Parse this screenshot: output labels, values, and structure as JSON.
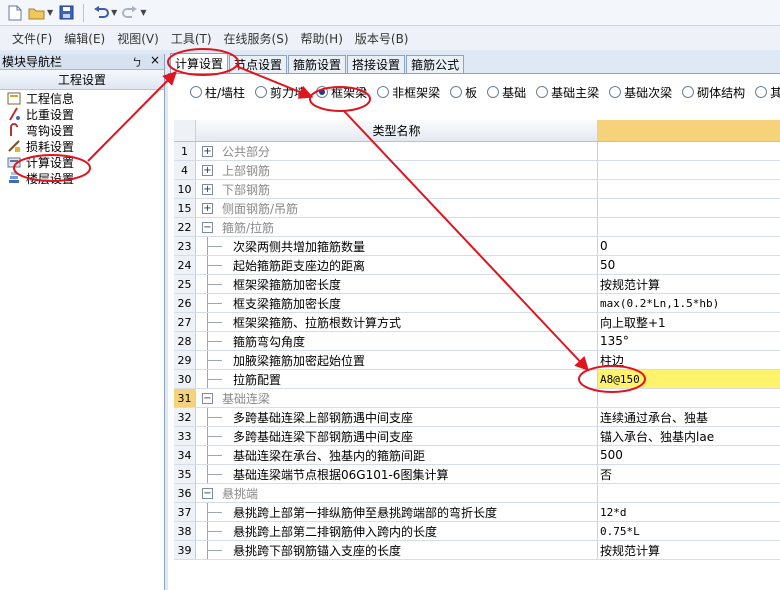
{
  "toolbar": {
    "icons": [
      "new-file-icon",
      "open-folder-icon",
      "save-icon",
      "undo-icon",
      "redo-icon"
    ]
  },
  "menu": [
    "文件(F)",
    "编辑(E)",
    "视图(V)",
    "工具(T)",
    "在线服务(S)",
    "帮助(H)",
    "版本号(B)"
  ],
  "left_panel": {
    "title": "模块导航栏",
    "pin": "ㄅ",
    "close": "×",
    "section": "工程设置",
    "items": [
      "工程信息",
      "比重设置",
      "弯钩设置",
      "损耗设置",
      "计算设置",
      "楼层设置"
    ]
  },
  "tabs": [
    "计算设置",
    "节点设置",
    "箍筋设置",
    "搭接设置",
    "箍筋公式"
  ],
  "radios": [
    "柱/墙柱",
    "剪力墙",
    "框架梁",
    "非框架梁",
    "板",
    "基础",
    "基础主梁",
    "基础次梁",
    "砌体结构",
    "其"
  ],
  "selected_radio": "框架梁",
  "grid": {
    "header": "类型名称",
    "rows": [
      {
        "n": "1",
        "kind": "cat",
        "exp": "+",
        "name": "公共部分",
        "value": ""
      },
      {
        "n": "4",
        "kind": "cat",
        "exp": "+",
        "name": "上部钢筋",
        "value": ""
      },
      {
        "n": "10",
        "kind": "cat",
        "exp": "+",
        "name": "下部钢筋",
        "value": ""
      },
      {
        "n": "15",
        "kind": "cat",
        "exp": "+",
        "name": "侧面钢筋/吊筋",
        "value": ""
      },
      {
        "n": "22",
        "kind": "cat",
        "exp": "−",
        "name": "箍筋/拉筋",
        "value": ""
      },
      {
        "n": "23",
        "kind": "item",
        "name": "次梁两侧共增加箍筋数量",
        "value": "0"
      },
      {
        "n": "24",
        "kind": "item",
        "name": "起始箍筋距支座边的距离",
        "value": "50"
      },
      {
        "n": "25",
        "kind": "item",
        "name": "框架梁箍筋加密长度",
        "value": "按规范计算"
      },
      {
        "n": "26",
        "kind": "item",
        "name": "框支梁箍筋加密长度",
        "value": "max(0.2*Ln,1.5*hb)",
        "mono": true
      },
      {
        "n": "27",
        "kind": "item",
        "name": "框架梁箍筋、拉筋根数计算方式",
        "value": "向上取整+1"
      },
      {
        "n": "28",
        "kind": "item",
        "name": "箍筋弯勾角度",
        "value": "135°"
      },
      {
        "n": "29",
        "kind": "item",
        "name": "加腋梁箍筋加密起始位置",
        "value": "柱边"
      },
      {
        "n": "30",
        "kind": "item",
        "name": "拉筋配置",
        "value": "A8@150",
        "hl": true,
        "mono": true
      },
      {
        "n": "31",
        "kind": "cat",
        "exp": "−",
        "name": "基础连梁",
        "value": "",
        "selected": true
      },
      {
        "n": "32",
        "kind": "item",
        "name": "多跨基础连梁上部钢筋遇中间支座",
        "value": "连续通过承台、独基"
      },
      {
        "n": "33",
        "kind": "item",
        "name": "多跨基础连梁下部钢筋遇中间支座",
        "value": "锚入承台、独基内lae"
      },
      {
        "n": "34",
        "kind": "item",
        "name": "基础连梁在承台、独基内的箍筋间距",
        "value": "500"
      },
      {
        "n": "35",
        "kind": "item",
        "name": "基础连梁端节点根据06G101-6图集计算",
        "value": "否"
      },
      {
        "n": "36",
        "kind": "cat",
        "exp": "−",
        "name": "悬挑端",
        "value": ""
      },
      {
        "n": "37",
        "kind": "item",
        "name": "悬挑跨上部第一排纵筋伸至悬挑跨端部的弯折长度",
        "value": "12*d",
        "mono": true
      },
      {
        "n": "38",
        "kind": "item",
        "name": "悬挑跨上部第二排钢筋伸入跨内的长度",
        "value": "0.75*L",
        "mono": true
      },
      {
        "n": "39",
        "kind": "item",
        "name": "悬挑跨下部钢筋锚入支座的长度",
        "value": "按规范计算"
      }
    ]
  },
  "colors": {
    "annotation": "#e0141e",
    "header_value": "#f6d27a",
    "highlight": "#fff36b"
  }
}
